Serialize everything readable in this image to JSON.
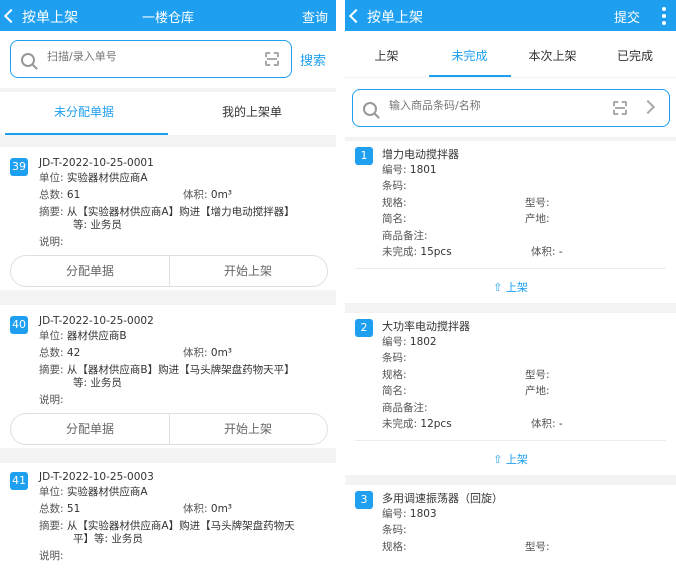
{
  "left": {
    "back_label": "按单上架",
    "title": "一楼仓库",
    "action": "查询",
    "search_placeholder": "扫描/录入单号",
    "search_button": "搜索",
    "tabs": [
      "未分配单据",
      "我的上架单"
    ],
    "cards": [
      {
        "num": "39",
        "code": "JD-T-2022-10-25-0001",
        "unit_label": "单位:",
        "unit": "实验器材供应商A",
        "total_label": "总数:",
        "total": "61",
        "vol_label": "体积:",
        "vol": "0m³",
        "summary_label": "摘要:",
        "summary_1": "从【实验器材供应商A】购进【增力电动搅拌器】",
        "summary_2": "等: 业务员",
        "note_label": "说明:",
        "btn1": "分配单据",
        "btn2": "开始上架"
      },
      {
        "num": "40",
        "code": "JD-T-2022-10-25-0002",
        "unit_label": "单位:",
        "unit": "器材供应商B",
        "total_label": "总数:",
        "total": "42",
        "vol_label": "体积:",
        "vol": "0m³",
        "summary_label": "摘要:",
        "summary_1": "从【器材供应商B】购进【马头牌架盘药物天平】",
        "summary_2": "等: 业务员",
        "note_label": "说明:",
        "btn1": "分配单据",
        "btn2": "开始上架"
      },
      {
        "num": "41",
        "code": "JD-T-2022-10-25-0003",
        "unit_label": "单位:",
        "unit": "实验器材供应商A",
        "total_label": "总数:",
        "total": "51",
        "vol_label": "体积:",
        "vol": "0m³",
        "summary_label": "摘要:",
        "summary_1": "从【实验器材供应商A】购进【马头牌架盘药物天",
        "summary_2": "平】等: 业务员",
        "note_label": "说明:"
      }
    ]
  },
  "right": {
    "back_label": "按单上架",
    "action": "提交",
    "tabs": [
      "上架",
      "未完成",
      "本次上架",
      "已完成"
    ],
    "search_placeholder": "输入商品条码/名称",
    "items": [
      {
        "num": "1",
        "name": "增力电动搅拌器",
        "code_label": "编号:",
        "code": "1801",
        "barcode_label": "条码:",
        "spec_label": "规格:",
        "model_label": "型号:",
        "short_label": "简名:",
        "origin_label": "产地:",
        "remark_label": "商品备注:",
        "pending_label": "未完成:",
        "pending": "15pcs",
        "vol_label": "体积:",
        "vol": "-",
        "up_label": "上架"
      },
      {
        "num": "2",
        "name": "大功率电动搅拌器",
        "code_label": "编号:",
        "code": "1802",
        "barcode_label": "条码:",
        "spec_label": "规格:",
        "model_label": "型号:",
        "short_label": "简名:",
        "origin_label": "产地:",
        "remark_label": "商品备注:",
        "pending_label": "未完成:",
        "pending": "12pcs",
        "vol_label": "体积:",
        "vol": "-",
        "up_label": "上架"
      },
      {
        "num": "3",
        "name": "多用调速振荡器（回旋）",
        "code_label": "编号:",
        "code": "1803",
        "barcode_label": "条码:",
        "spec_label": "规格:",
        "model_label": "型号:"
      }
    ]
  },
  "colors": {
    "accent": "#1e9ff0"
  }
}
